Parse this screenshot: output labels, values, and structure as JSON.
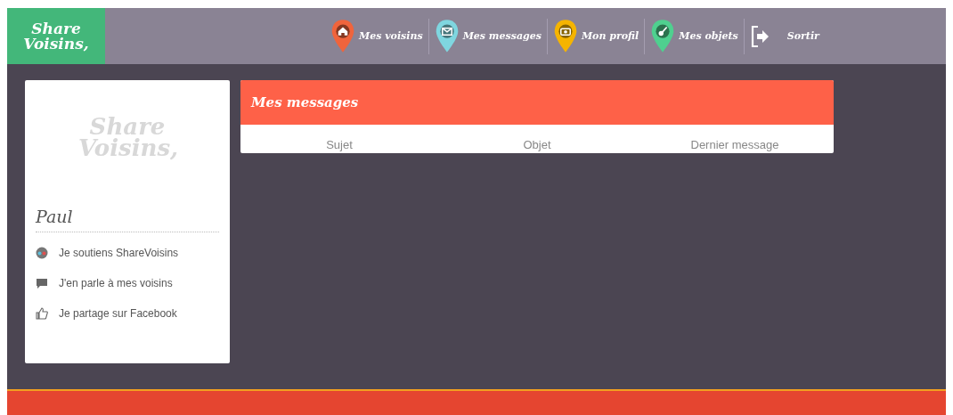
{
  "header": {
    "logo": [
      "Share",
      "Voisins,"
    ],
    "nav": [
      {
        "label": "Mes voisins",
        "kind": "pin",
        "color": "#f0643c"
      },
      {
        "label": "Mes messages",
        "kind": "pin",
        "color": "#7fd6e0"
      },
      {
        "label": "Mon profil",
        "kind": "pin",
        "color": "#f5b400"
      },
      {
        "label": "Mes objets",
        "kind": "pin",
        "color": "#4fd08f"
      },
      {
        "label": "Sortir",
        "kind": "exit"
      }
    ]
  },
  "sidebar": {
    "logo": [
      "Share",
      "Voisins,"
    ],
    "name": "Paul",
    "links": [
      {
        "label": "Je soutiens ShareVoisins"
      },
      {
        "label": "J'en parle à mes voisins"
      },
      {
        "label": "Je partage sur Facebook"
      }
    ]
  },
  "messages": {
    "title": "Mes messages",
    "columns": [
      "Sujet",
      "Objet",
      "Dernier message"
    ]
  }
}
